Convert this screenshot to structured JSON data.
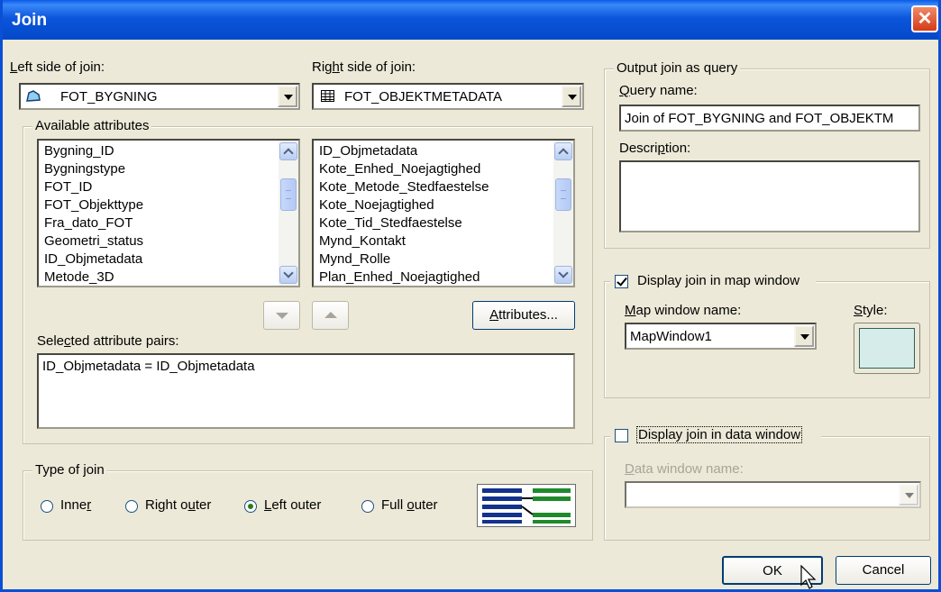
{
  "window": {
    "title": "Join",
    "close_label": "✕"
  },
  "left": {
    "label": "Left side of join:",
    "table": "FOT_BYGNING",
    "table_icon": "polygon-layer-icon",
    "attributes": [
      "Bygning_ID",
      "Bygningstype",
      "FOT_ID",
      "FOT_Objekttype",
      "Fra_dato_FOT",
      "Geometri_status",
      "ID_Objmetadata",
      "Metode_3D"
    ]
  },
  "right": {
    "label": "Right side of join:",
    "table": "FOT_OBJEKTMETADATA",
    "table_icon": "table-icon",
    "attributes": [
      "ID_Objmetadata",
      "Kote_Enhed_Noejagtighed",
      "Kote_Metode_Stedfaestelse",
      "Kote_Noejagtighed",
      "Kote_Tid_Stedfaestelse",
      "Mynd_Kontakt",
      "Mynd_Rolle",
      "Plan_Enhed_Noejagtighed"
    ]
  },
  "available": {
    "legend": "Available attributes",
    "attributes_button": "Attributes..."
  },
  "selected": {
    "label": "Selected attribute pairs:",
    "pairs": [
      "ID_Objmetadata = ID_Objmetadata"
    ]
  },
  "join_type": {
    "legend": "Type of join",
    "options": [
      "Inner",
      "Right outer",
      "Left outer",
      "Full outer"
    ],
    "selected": "Left outer"
  },
  "output": {
    "legend": "Output join as query",
    "query_name_label": "Query name:",
    "query_name_value": "Join of FOT_BYGNING and FOT_OBJEKTM",
    "description_label": "Description:",
    "description_value": ""
  },
  "map": {
    "checkbox_label": "Display join in map window",
    "checked": true,
    "window_name_label": "Map window name:",
    "window_name_value": "MapWindow1",
    "style_label": "Style:"
  },
  "data_window": {
    "checkbox_label": "Display join in data window",
    "checked": false,
    "window_name_label": "Data window name:",
    "window_name_value": ""
  },
  "buttons": {
    "ok": "OK",
    "cancel": "Cancel"
  },
  "colors": {
    "title_bar": "#0a5ae8",
    "dialog_bg": "#ece9d8",
    "close_button": "#d43a16"
  }
}
